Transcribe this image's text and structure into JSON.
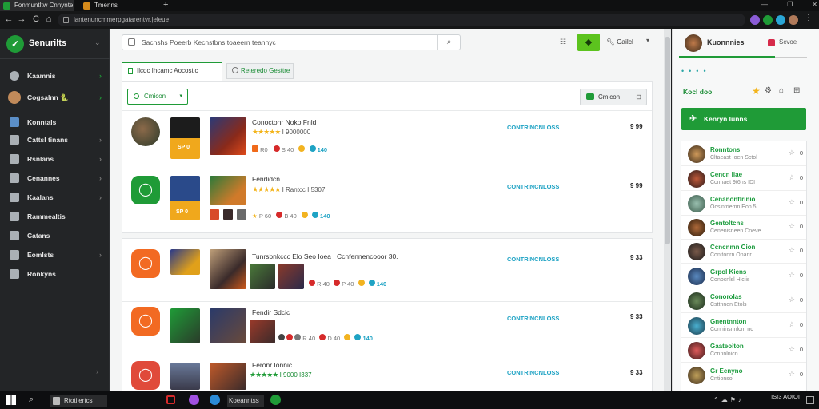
{
  "browser": {
    "tabs": [
      {
        "label": "Fonmuntltw Cnnynte",
        "active": true
      },
      {
        "label": "Tmenns",
        "active": false
      }
    ],
    "new_tab": "+",
    "url": "lantenuncmmerpgatarentvr.|eleue",
    "nav": {
      "back": "←",
      "forward": "→",
      "reload": "C",
      "home": "⌂"
    },
    "window_controls": [
      "—",
      "❐",
      "✕"
    ]
  },
  "sidebar": {
    "logo_text": "Senurilts",
    "items": [
      {
        "label": "Kaamnis",
        "icon": "grid-icon"
      },
      {
        "label": "Cogsalnn 🐍",
        "icon": "avatar-icon"
      },
      {
        "label": "Konntals",
        "icon": "library-icon"
      },
      {
        "label": "Cattsl tinans",
        "icon": "controller-icon"
      },
      {
        "label": "Rsnlans",
        "icon": "download-icon"
      },
      {
        "label": "Cenannes",
        "icon": "cart-icon"
      },
      {
        "label": "Kaalans",
        "icon": "bag-icon"
      },
      {
        "label": "Rammealtis",
        "icon": "music-icon"
      },
      {
        "label": "Catans",
        "icon": "people-icon"
      },
      {
        "label": "Eomlsts",
        "icon": "mail-icon"
      },
      {
        "label": "Ronkyns",
        "icon": "gift-icon"
      }
    ]
  },
  "header": {
    "search_value": "Sacnshs Poeerb Kecnstbns toaeern teannyc",
    "settings_label": "Cailcl"
  },
  "tabs": [
    {
      "label": "Ilcdc Ihcamc Aocostic"
    },
    {
      "label": "Reteredo Gesttre"
    }
  ],
  "filter": {
    "dropdown": "Cmicon",
    "action": "Cmicon"
  },
  "groups": [
    {
      "rows": [
        {
          "title": "Conoctonr Noko Fnld",
          "rating": "★★★★★",
          "rating_text": "I 9000000",
          "platform": "CONTRINCNLOSS",
          "price": "9 99",
          "stats": [
            "R0",
            "S 40",
            "P 40",
            "140"
          ]
        },
        {
          "title": "Fenrlidcn",
          "rating": "★★★★★",
          "rating_text": "I Rantcc I 5307",
          "platform": "CONTRINCNLOSS",
          "price": "9 99",
          "stats": [
            "P 60",
            "B 40",
            "140"
          ]
        }
      ]
    },
    {
      "rows": [
        {
          "title": "Tunrsbnkccc Elo Seo Ioea I Ccnfennencooor 30.",
          "rating": "",
          "rating_text": "",
          "platform": "CONTRINCNLOSS",
          "price": "9 33",
          "stats": [
            "R 40",
            "P 40",
            "140"
          ]
        },
        {
          "title": "Fendir Sdcic",
          "rating": "",
          "rating_text": "",
          "platform": "CONTRINCNLOSS",
          "price": "9 33",
          "stats": [
            "R 40",
            "D 40",
            "140"
          ]
        },
        {
          "title": "Feronr Ionnic",
          "rating": "★★★★★",
          "rating_text": "I 9000 I337",
          "platform": "CONTRINCNLOSS",
          "price": "9 33",
          "stats": []
        }
      ]
    }
  ],
  "right_panel": {
    "title": "Kuonnnies",
    "action": "Scvoe",
    "section_label": "Kocl doo",
    "primary_button": "Kenryn Iunns",
    "friends": [
      {
        "name": "Ronntons",
        "status": "Cltaeast Ioen Sctol",
        "num": "0"
      },
      {
        "name": "Cencn Iiae",
        "status": "Ccnnaet 9t6ns IDI",
        "num": "0"
      },
      {
        "name": "Cenanontlrinio",
        "status": "Ocsintriemn Eon 5",
        "num": "0"
      },
      {
        "name": "Gentoltcns",
        "status": "Cenenisneen Cneve",
        "num": "0"
      },
      {
        "name": "Ccncnmn Cion",
        "status": "Conitonrn Onanr",
        "num": "0"
      },
      {
        "name": "Grpol Kicns",
        "status": "Conocnlsl Hiclis",
        "num": "0"
      },
      {
        "name": "Conorolas",
        "status": "Csttnnen Etols",
        "num": "0"
      },
      {
        "name": "Gnentnnton",
        "status": "Conninsnnlcm nc",
        "num": "0"
      },
      {
        "name": "Gaateoiton",
        "status": "Ccnnnlnicn",
        "num": "0"
      },
      {
        "name": "Gr Eenyno",
        "status": "Cntionso",
        "num": "0"
      }
    ]
  },
  "taskbar": {
    "app_label": "Rtotiiertcs",
    "app2_label": "Koeanntss",
    "clock": "ISI3 AOIOI"
  },
  "colors": {
    "accent": "#1f9b37",
    "link": "#1fa3c4",
    "star": "#f3b41b"
  }
}
